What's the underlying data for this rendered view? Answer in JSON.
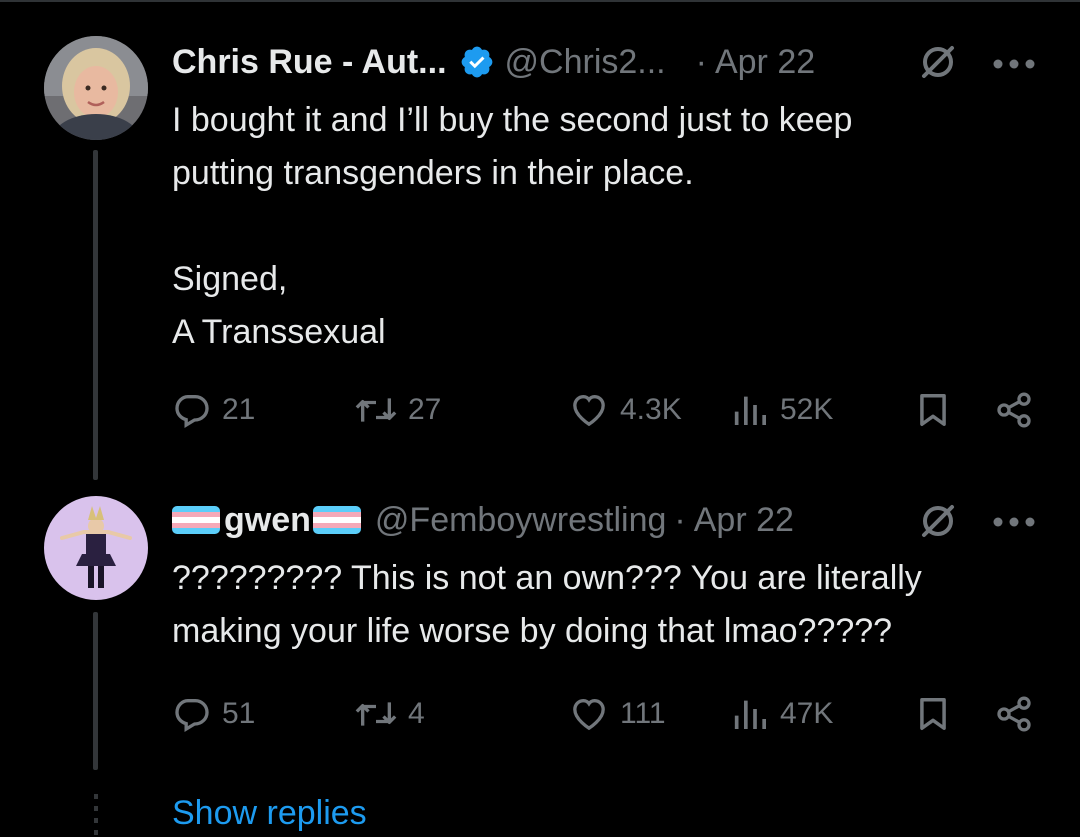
{
  "tweets": [
    {
      "name": "Chris Rue - Aut...",
      "handle": "@Chris2...",
      "separator": "·",
      "date": "Apr 22",
      "text": "I bought it and I’ll buy the second just to keep\nputting transgenders in their place.\n\nSigned,\nA Transsexual",
      "stats": {
        "replies": "21",
        "reposts": "27",
        "likes": "4.3K",
        "views": "52K"
      }
    },
    {
      "name": "gwen",
      "handle": "@Femboywrestling",
      "separator": "·",
      "date": "Apr 22",
      "text": "????????? This is not an own??? You are literally\nmaking your life worse by doing that lmao?????",
      "stats": {
        "replies": "51",
        "reposts": "4",
        "likes": "111",
        "views": "47K"
      }
    }
  ],
  "show_replies": "Show replies",
  "colors": {
    "background": "#000000",
    "text": "#e7e9ea",
    "muted": "#71767b",
    "link": "#1d9bf0",
    "verified": "#1d9bf0"
  },
  "icons": [
    "reply-icon",
    "repost-icon",
    "like-icon",
    "views-icon",
    "bookmark-icon",
    "share-icon",
    "grok-icon",
    "more-icon",
    "verified-badge-icon",
    "trans-flag-icon"
  ]
}
